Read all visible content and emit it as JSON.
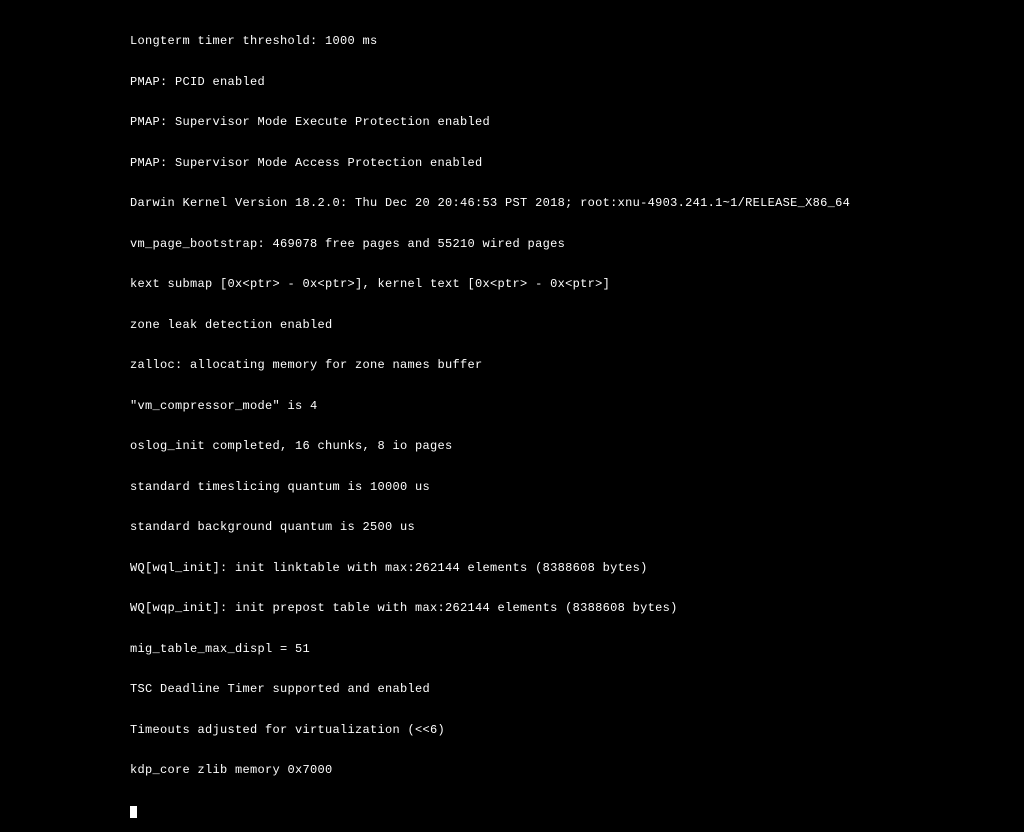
{
  "boot_log": {
    "lines": [
      "Longterm timer threshold: 1000 ms",
      "PMAP: PCID enabled",
      "PMAP: Supervisor Mode Execute Protection enabled",
      "PMAP: Supervisor Mode Access Protection enabled",
      "Darwin Kernel Version 18.2.0: Thu Dec 20 20:46:53 PST 2018; root:xnu-4903.241.1~1/RELEASE_X86_64",
      "vm_page_bootstrap: 469078 free pages and 55210 wired pages",
      "kext submap [0x<ptr> - 0x<ptr>], kernel text [0x<ptr> - 0x<ptr>]",
      "zone leak detection enabled",
      "zalloc: allocating memory for zone names buffer",
      "\"vm_compressor_mode\" is 4",
      "oslog_init completed, 16 chunks, 8 io pages",
      "standard timeslicing quantum is 10000 us",
      "standard background quantum is 2500 us",
      "WQ[wql_init]: init linktable with max:262144 elements (8388608 bytes)",
      "WQ[wqp_init]: init prepost table with max:262144 elements (8388608 bytes)",
      "mig_table_max_displ = 51",
      "TSC Deadline Timer supported and enabled",
      "Timeouts adjusted for virtualization (<<6)",
      "kdp_core zlib memory 0x7000"
    ]
  }
}
